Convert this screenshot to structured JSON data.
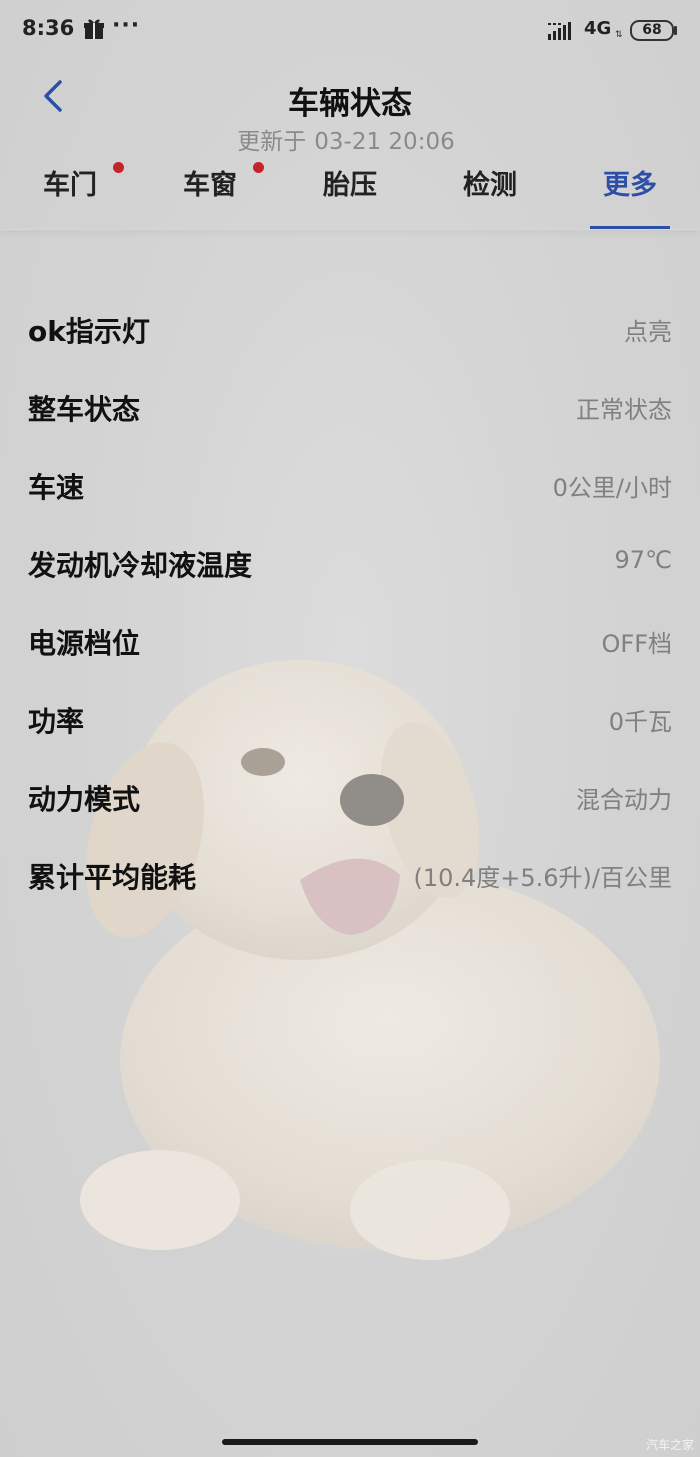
{
  "status_bar": {
    "time": "8:36",
    "more_dots": "···",
    "network": "4G",
    "network_arrows": "⇅",
    "battery": "68"
  },
  "header": {
    "title": "车辆状态",
    "update_prefix": "更新于",
    "update_time": "03-21 20:06"
  },
  "tabs": [
    {
      "label": "车门",
      "has_dot": true
    },
    {
      "label": "车窗",
      "has_dot": true
    },
    {
      "label": "胎压",
      "has_dot": false
    },
    {
      "label": "检测",
      "has_dot": false
    },
    {
      "label": "更多",
      "has_dot": false,
      "active": true
    }
  ],
  "status_items": [
    {
      "label": "ok指示灯",
      "value": "点亮"
    },
    {
      "label": "整车状态",
      "value": "正常状态"
    },
    {
      "label": "车速",
      "value": "0公里/小时"
    },
    {
      "label": "发动机冷却液温度",
      "value": "97℃"
    },
    {
      "label": "电源档位",
      "value": "OFF档"
    },
    {
      "label": "功率",
      "value": "0千瓦"
    },
    {
      "label": "动力模式",
      "value": "混合动力"
    },
    {
      "label": "累计平均能耗",
      "value": "(10.4度+5.6升)/百公里"
    }
  ],
  "watermark": "汽车之家",
  "colors": {
    "accent": "#2d4fa8",
    "badge": "#c4232b",
    "value_text": "#808080"
  }
}
